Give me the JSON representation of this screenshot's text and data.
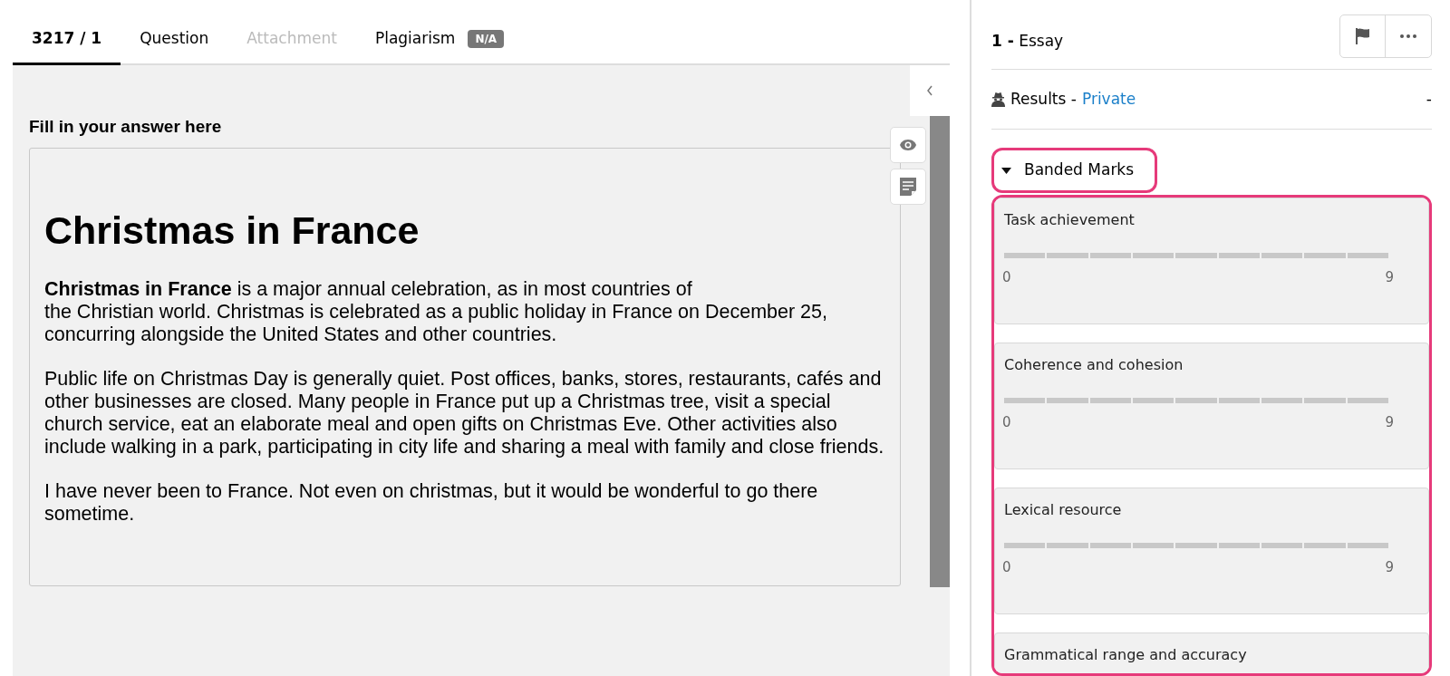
{
  "tabs": [
    {
      "label": "3217 / 1",
      "selected": true,
      "disabled": false
    },
    {
      "label": "Question",
      "selected": false,
      "disabled": false
    },
    {
      "label": "Attachment",
      "selected": false,
      "disabled": true
    },
    {
      "label": "Plagiarism",
      "selected": false,
      "disabled": false,
      "badge": "N/A"
    }
  ],
  "answer": {
    "label": "Fill in your answer here",
    "heading": "Christmas in France",
    "paragraphs": [
      "**Christmas in France** is a major annual celebration, as in most countries of\nthe Christian world. Christmas is celebrated as a public holiday in France on December 25,\nconcurring alongside the United States and other countries.",
      "Public life on Christmas Day is generally quiet. Post offices, banks, stores, restaurants, cafés and\nother businesses are closed. Many people in France put up a Christmas tree, visit a special\nchurch service, eat an elaborate meal and open gifts on Christmas Eve. Other activities also\ninclude walking in a park, participating in city life and sharing a meal with family and close friends.",
      "I have never been to France. Not even on christmas, but it would be wonderful to go there\nsometime."
    ]
  },
  "sidebar": {
    "question_title": "**1 -** Essay",
    "results_label": "Results -",
    "results_visibility": "Private",
    "results_value": "-",
    "banded_marks": {
      "title": "Banded Marks",
      "expanded": true,
      "criteria": [
        {
          "name": "Task achievement",
          "min": "0",
          "max": "9",
          "level": 0
        },
        {
          "name": "Coherence and cohesion",
          "min": "0",
          "max": "9",
          "level": 0
        },
        {
          "name": "Lexical resource",
          "min": "0",
          "max": "9",
          "level": 0
        },
        {
          "name": "Grammatical range and accuracy"
        }
      ]
    }
  }
}
